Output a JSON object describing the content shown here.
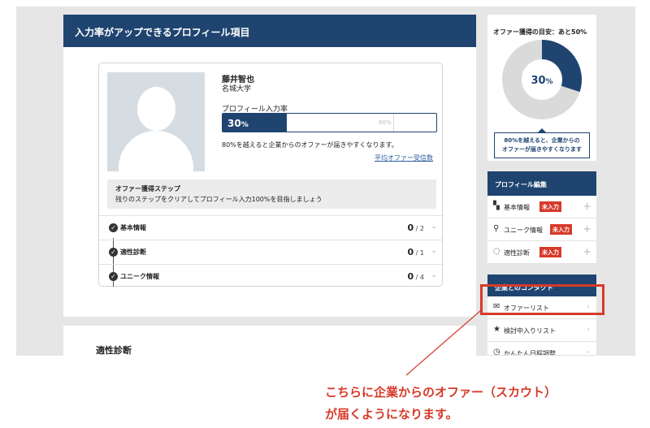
{
  "main": {
    "header_title": "入力率がアップできるプロフィール項目",
    "profile": {
      "name": "藤井智也",
      "school": "名城大学",
      "rate_label": "プロフィール入力率",
      "rate_value": "30",
      "rate_unit": "%",
      "rate_fraction": 0.3,
      "target_fraction": 0.8,
      "target_label": "80%",
      "note": "80%を越えると企業からのオファーが届きやすくなります。",
      "avg_link": "平均オファー受信数"
    },
    "steps_box": {
      "title": "オファー獲得ステップ",
      "desc": "残りのステップをクリアしてプロフィール入力100%を目指しましょう"
    },
    "steps": [
      {
        "label": "基本情報",
        "done": "0",
        "total": "/ 2"
      },
      {
        "label": "適性診断",
        "done": "0",
        "total": "/ 1"
      },
      {
        "label": "ユニーク情報",
        "done": "0",
        "total": "/ 4"
      }
    ],
    "section_title": "適性診断"
  },
  "sidebar": {
    "goal_title": "オファー獲得の目安：あと50%",
    "donut_value": "30",
    "donut_unit": "%",
    "donut_fraction": 0.3,
    "goal_note_line1": "80%を越えると、企業からの",
    "goal_note_line2": "オファーが届きやすくなります",
    "profile_edit_header": "プロフィール編集",
    "profile_items": [
      {
        "label": "基本情報",
        "badge": "未入力",
        "icon": "person-card-icon"
      },
      {
        "label": "ユニーク情報",
        "badge": "未入力",
        "icon": "runner-icon"
      },
      {
        "label": "適性診断",
        "badge": "未入力",
        "icon": "dotted-circle-icon"
      }
    ],
    "contact_header": "企業とのコンタクト",
    "contact_items": [
      {
        "label": "オファーリスト",
        "icon": "envelope-icon"
      },
      {
        "label": "検討中入りリスト",
        "icon": "star-icon"
      },
      {
        "label": "かんたん日程調整",
        "icon": "clock-icon"
      }
    ]
  },
  "callout": {
    "line1": "こちらに企業からのオファー（スカウト）",
    "line2": "が届くようになります。"
  },
  "colors": {
    "navy": "#1f4470",
    "accent_red": "#d63a2a",
    "background_gray": "#e6e6e6"
  }
}
